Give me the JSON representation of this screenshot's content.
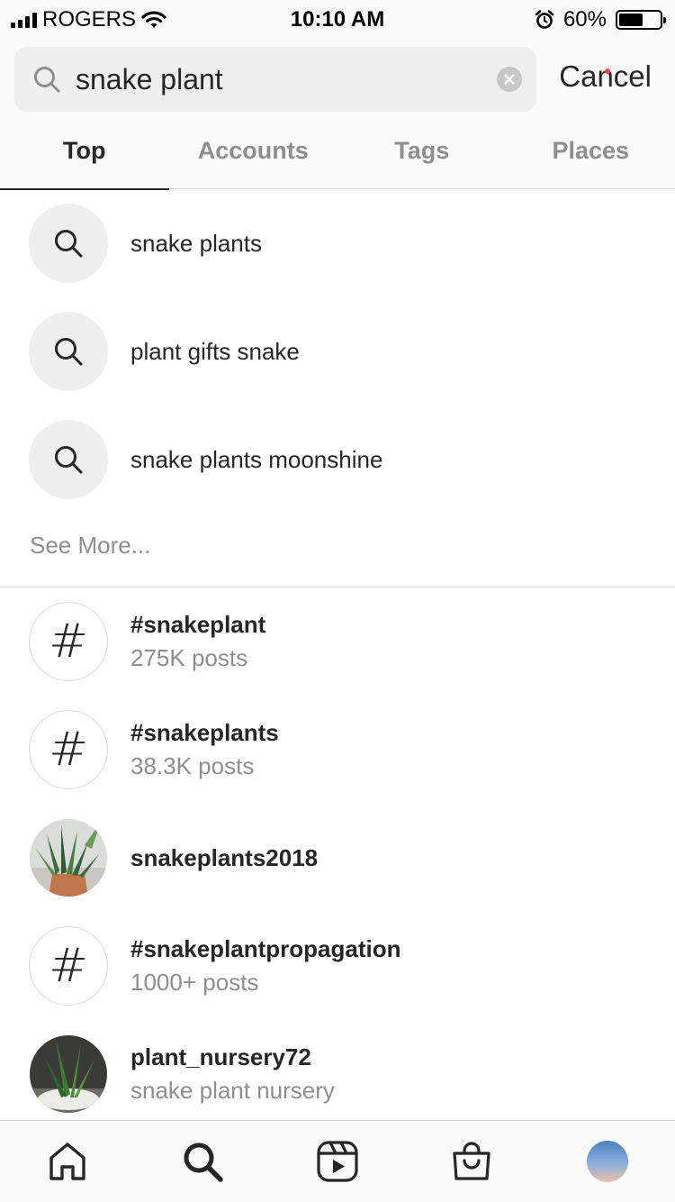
{
  "status_bar": {
    "carrier": "ROGERS",
    "time": "10:10 AM",
    "battery": "60%",
    "battery_level": 0.6,
    "icons": [
      "signal-icon",
      "wifi-icon",
      "alarm-icon",
      "battery-icon"
    ]
  },
  "search": {
    "query": "snake plant",
    "cancel_label": "Cancel"
  },
  "tabs": [
    {
      "label": "Top",
      "active": true
    },
    {
      "label": "Accounts",
      "active": false
    },
    {
      "label": "Tags",
      "active": false
    },
    {
      "label": "Places",
      "active": false
    }
  ],
  "suggestions": [
    {
      "label": "snake plants"
    },
    {
      "label": "plant gifts snake"
    },
    {
      "label": "snake plants moonshine"
    }
  ],
  "see_more_label": "See More...",
  "results": [
    {
      "kind": "hashtag",
      "title": "#snakeplant",
      "subtitle": "275K posts"
    },
    {
      "kind": "hashtag",
      "title": "#snakeplants",
      "subtitle": "38.3K posts"
    },
    {
      "kind": "account",
      "title": "snakeplants2018",
      "subtitle": ""
    },
    {
      "kind": "hashtag",
      "title": "#snakeplantpropagation",
      "subtitle": "1000+ posts"
    },
    {
      "kind": "account",
      "title": "plant_nursery72",
      "subtitle": "snake plant nursery"
    }
  ],
  "tab_bar": {
    "items": [
      "home-icon",
      "search-icon",
      "reels-icon",
      "shop-icon",
      "profile-avatar"
    ]
  },
  "colors": {
    "text_primary": "#262626",
    "text_secondary": "#8e8e8e",
    "divider": "#dbdbdb",
    "field_bg": "#efefef",
    "notification_dot": "#ed4956"
  }
}
